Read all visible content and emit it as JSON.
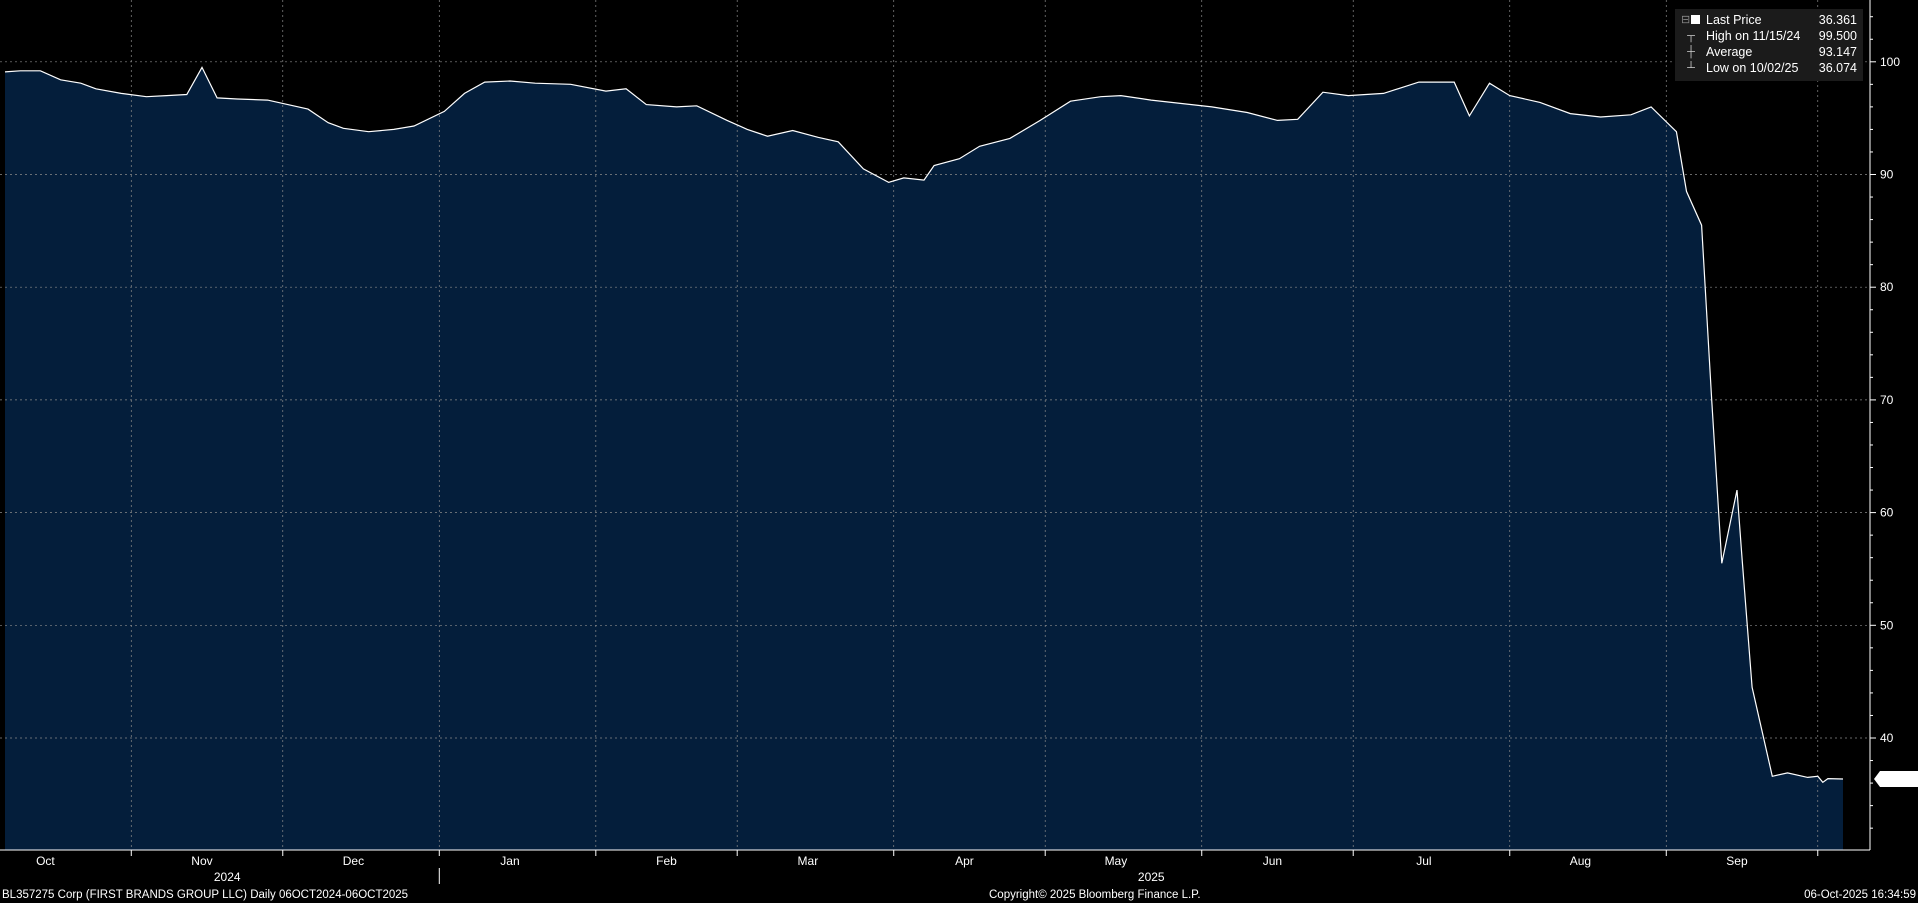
{
  "chart_data": {
    "type": "area",
    "title": "",
    "xlabel": "",
    "ylabel": "",
    "ylim": [
      30,
      105
    ],
    "y_ticks": [
      40,
      50,
      60,
      70,
      80,
      90,
      100
    ],
    "grid": true,
    "legend_position": "top-right",
    "colors": {
      "background": "#000000",
      "area_fill": "#041e3b",
      "line": "#ffffff",
      "grid": "#8a8a8a",
      "legend_bg": "#1b1b1b"
    },
    "x_range": [
      "2024-10-06",
      "2025-10-06"
    ],
    "month_ticks": [
      {
        "date": "2024-10-15",
        "label": "Oct"
      },
      {
        "date": "2024-11-15",
        "label": "Nov"
      },
      {
        "date": "2024-12-15",
        "label": "Dec"
      },
      {
        "date": "2025-01-15",
        "label": "Jan"
      },
      {
        "date": "2025-02-15",
        "label": "Feb"
      },
      {
        "date": "2025-03-15",
        "label": "Mar"
      },
      {
        "date": "2025-04-15",
        "label": "Apr"
      },
      {
        "date": "2025-05-15",
        "label": "May"
      },
      {
        "date": "2025-06-15",
        "label": "Jun"
      },
      {
        "date": "2025-07-15",
        "label": "Jul"
      },
      {
        "date": "2025-08-15",
        "label": "Aug"
      },
      {
        "date": "2025-09-15",
        "label": "Sep"
      }
    ],
    "year_ticks": [
      {
        "date": "2024-11-20",
        "label": "2024"
      },
      {
        "date": "2025-05-22",
        "label": "2025"
      }
    ],
    "series": [
      {
        "name": "Last Price",
        "x": [
          "2024-10-07",
          "2024-10-10",
          "2024-10-14",
          "2024-10-18",
          "2024-10-22",
          "2024-10-25",
          "2024-10-30",
          "2024-11-04",
          "2024-11-08",
          "2024-11-12",
          "2024-11-15",
          "2024-11-18",
          "2024-11-22",
          "2024-11-28",
          "2024-12-02",
          "2024-12-06",
          "2024-12-10",
          "2024-12-13",
          "2024-12-18",
          "2024-12-23",
          "2024-12-27",
          "2025-01-02",
          "2025-01-06",
          "2025-01-10",
          "2025-01-15",
          "2025-01-20",
          "2025-01-27",
          "2025-02-03",
          "2025-02-07",
          "2025-02-11",
          "2025-02-17",
          "2025-02-21",
          "2025-02-27",
          "2025-03-03",
          "2025-03-07",
          "2025-03-12",
          "2025-03-17",
          "2025-03-21",
          "2025-03-26",
          "2025-03-31",
          "2025-04-03",
          "2025-04-07",
          "2025-04-09",
          "2025-04-14",
          "2025-04-18",
          "2025-04-24",
          "2025-04-30",
          "2025-05-06",
          "2025-05-12",
          "2025-05-16",
          "2025-05-22",
          "2025-05-28",
          "2025-06-03",
          "2025-06-10",
          "2025-06-16",
          "2025-06-20",
          "2025-06-25",
          "2025-06-30",
          "2025-07-07",
          "2025-07-14",
          "2025-07-21",
          "2025-07-24",
          "2025-07-28",
          "2025-08-01",
          "2025-08-07",
          "2025-08-13",
          "2025-08-19",
          "2025-08-25",
          "2025-08-29",
          "2025-09-03",
          "2025-09-05",
          "2025-09-08",
          "2025-09-10",
          "2025-09-12",
          "2025-09-15",
          "2025-09-16",
          "2025-09-18",
          "2025-09-22",
          "2025-09-25",
          "2025-09-29",
          "2025-10-01",
          "2025-10-02",
          "2025-10-03",
          "2025-10-06"
        ],
        "values": [
          99.1,
          99.2,
          99.2,
          98.4,
          98.1,
          97.6,
          97.2,
          96.9,
          97.0,
          97.1,
          99.5,
          96.8,
          96.7,
          96.6,
          96.2,
          95.8,
          94.6,
          94.1,
          93.8,
          94.0,
          94.3,
          95.6,
          97.2,
          98.2,
          98.3,
          98.1,
          98.0,
          97.4,
          97.6,
          96.2,
          96.0,
          96.1,
          94.8,
          94.0,
          93.4,
          93.9,
          93.3,
          92.9,
          90.5,
          89.3,
          89.7,
          89.5,
          90.8,
          91.4,
          92.5,
          93.2,
          94.8,
          96.5,
          96.9,
          97.0,
          96.6,
          96.3,
          96.0,
          95.5,
          94.8,
          94.9,
          97.3,
          97.0,
          97.2,
          98.2,
          98.2,
          95.2,
          98.1,
          97.0,
          96.4,
          95.4,
          95.1,
          95.3,
          96.0,
          93.8,
          88.5,
          85.5,
          70.0,
          55.5,
          62.0,
          56.0,
          44.5,
          36.6,
          36.9,
          36.5,
          36.6,
          36.07,
          36.4,
          36.361
        ]
      }
    ],
    "last_price_label": "36.361",
    "legend": {
      "items": [
        {
          "label": "Last Price",
          "value": "36.361",
          "icon": "filled-square-icon"
        },
        {
          "label": "High on 11/15/24",
          "value": "99.500",
          "icon": "high-marker-icon"
        },
        {
          "label": "Average",
          "value": "93.147",
          "icon": "average-marker-icon"
        },
        {
          "label": "Low on 10/02/25",
          "value": "36.074",
          "icon": "low-marker-icon"
        }
      ]
    }
  },
  "footer": {
    "security": "BL357275 Corp (FIRST BRANDS GROUP LLC) Daily 06OCT2024-06OCT2025",
    "copyright": "Copyright© 2025 Bloomberg Finance L.P.",
    "timestamp": "06-Oct-2025 16:34:59"
  }
}
